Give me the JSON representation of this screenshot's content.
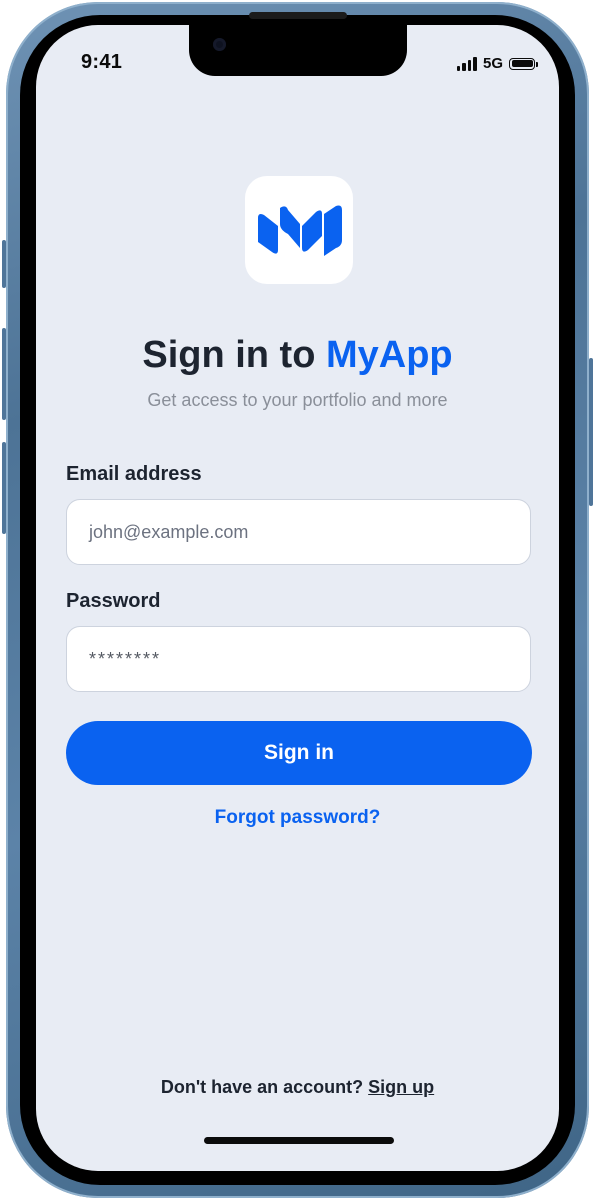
{
  "status_bar": {
    "time": "9:41",
    "network": "5G"
  },
  "app": {
    "logo_icon": "myapp-logo-icon",
    "brand_color": "#0a62f0"
  },
  "header": {
    "title_prefix": "Sign in to ",
    "title_brand": "MyApp",
    "subtitle": "Get access to your portfolio and more"
  },
  "form": {
    "email_label": "Email address",
    "email_placeholder": "john@example.com",
    "password_label": "Password",
    "password_value": "********",
    "submit_label": "Sign in",
    "forgot_label": "Forgot password?"
  },
  "footer": {
    "prompt": "Don't have an account? ",
    "signup_label": "Sign up"
  }
}
